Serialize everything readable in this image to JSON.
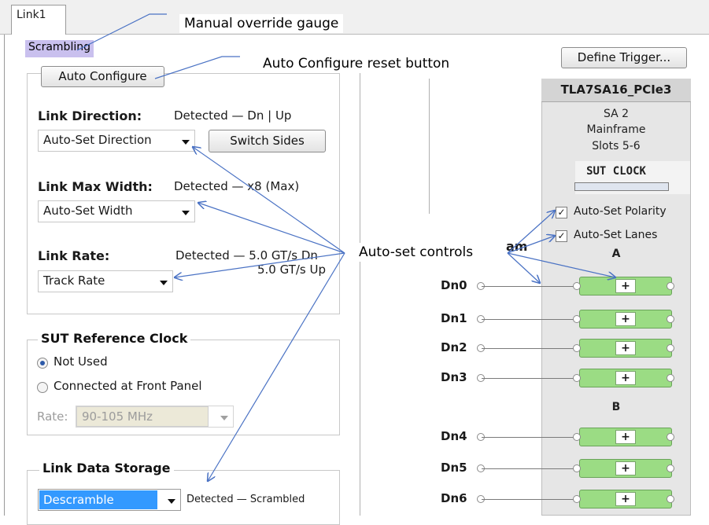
{
  "tab": {
    "label": "Link1"
  },
  "scrambling_label": "Scrambling",
  "auto_configure_label": "Auto Configure",
  "define_trigger_label": "Define Trigger...",
  "link_direction": {
    "label": "Link Direction:",
    "detected": "Detected — Dn | Up",
    "combo_value": "Auto-Set Direction",
    "switch_sides_label": "Switch Sides"
  },
  "link_max_width": {
    "label": "Link Max Width:",
    "detected": "Detected — x8 (Max)",
    "combo_value": "Auto-Set Width"
  },
  "link_rate": {
    "label": "Link Rate:",
    "detected_line1": "Detected — 5.0 GT/s Dn",
    "detected_line2": "5.0 GT/s Up",
    "combo_value": "Track Rate"
  },
  "sut_ref_clock": {
    "title": "SUT Reference Clock",
    "options": [
      "Not Used",
      "Connected at Front Panel"
    ],
    "selected": "Not Used",
    "rate_label": "Rate:",
    "rate_value": "90-105 MHz"
  },
  "link_data_storage": {
    "title": "Link Data Storage",
    "combo_value": "Descramble",
    "detected": "Detected — Scrambled"
  },
  "module": {
    "title": "TLA7SA16_PCIe3",
    "sa": "SA 2",
    "mainframe": "Mainframe",
    "slots": "Slots 5-6",
    "sut_clock": "SUT CLOCK",
    "auto_set_polarity": "Auto-Set Polarity",
    "auto_set_lanes": "Auto-Set Lanes",
    "group_a": "A",
    "group_b": "B"
  },
  "downstream_partial": "am",
  "lanes": [
    "Dn0",
    "Dn1",
    "Dn2",
    "Dn3",
    "Dn4",
    "Dn5",
    "Dn6"
  ],
  "callouts": {
    "manual_override": "Manual override gauge",
    "auto_configure": "Auto  Configure reset button",
    "auto_set": "Auto-set controls"
  },
  "colors": {
    "arrow": "#4a72c4",
    "probe": "#9bdc84",
    "selection": "#3399ff",
    "scrambling_bg": "#c9c0ee"
  }
}
